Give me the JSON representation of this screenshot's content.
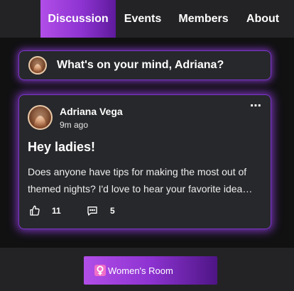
{
  "nav": {
    "tabs": [
      {
        "label": "Discussion",
        "active": true
      },
      {
        "label": "Events",
        "active": false
      },
      {
        "label": "Members",
        "active": false
      },
      {
        "label": "About",
        "active": false
      }
    ]
  },
  "composer": {
    "prompt": "What's on your mind, Adriana?",
    "avatar_icon": "user-avatar"
  },
  "post": {
    "author": "Adriana Vega",
    "time": "9m ago",
    "title": "Hey ladies!",
    "body": "Does anyone have tips for making the most out of themed nights? I'd love to hear your favorite ideas and experiences!",
    "more_icon": "ellipsis-icon",
    "likes": "11",
    "comments": "5",
    "like_icon": "thumbs-up-icon",
    "comment_icon": "comment-icon"
  },
  "footer": {
    "room_label": "Women's Room",
    "room_icon": "female-symbol-icon"
  },
  "colors": {
    "accent_start": "#b24ee8",
    "accent_end": "#5f1a9c",
    "card_bg": "#27282b",
    "glow": "#963ce6",
    "room_icon_bg": "#f06fc8"
  }
}
